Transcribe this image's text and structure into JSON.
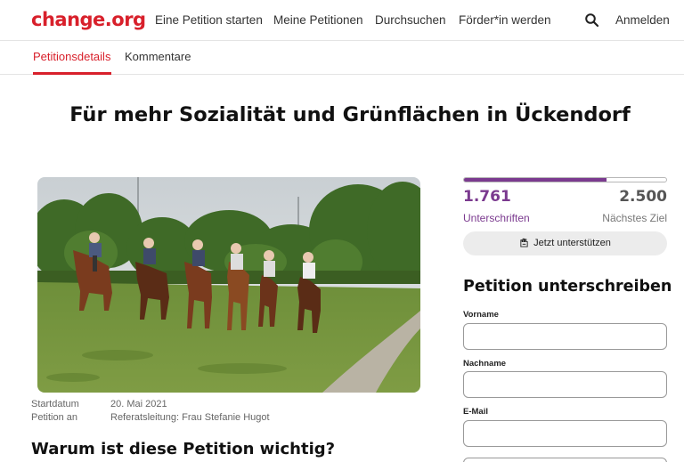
{
  "header": {
    "logo": "change.org",
    "nav": [
      "Eine Petition starten",
      "Meine Petitionen",
      "Durchsuchen",
      "Förder*in werden"
    ],
    "search_icon": "search-icon",
    "login": "Anmelden",
    "brand_color": "#d8202b"
  },
  "tabs": {
    "details": "Petitionsdetails",
    "comments": "Kommentare"
  },
  "petition": {
    "title": "Für mehr Sozialität und Grünflächen in Ückendorf",
    "image_alt": "Reiterinnen mit Pferden auf einer Wiese",
    "start_label": "Startdatum",
    "start_value": "20. Mai 2021",
    "target_label": "Petition an",
    "target_value": "Referatsleitung: Frau Stefanie Hugot",
    "why_heading": "Warum ist diese Petition wichtig?"
  },
  "progress": {
    "signatures": "1.761",
    "signatures_label": "Unterschriften",
    "goal": "2.500",
    "goal_label": "Nächstes Ziel",
    "fraction": 0.7044,
    "accent_color": "#7b3a8f"
  },
  "support_button": {
    "icon": "support-hand-icon",
    "label": "Jetzt unterstützen"
  },
  "sign_form": {
    "title": "Petition unterschreiben",
    "first_name_label": "Vorname",
    "first_name_value": "",
    "last_name_label": "Nachname",
    "last_name_value": "",
    "email_label": "E-Mail",
    "email_value": ""
  }
}
